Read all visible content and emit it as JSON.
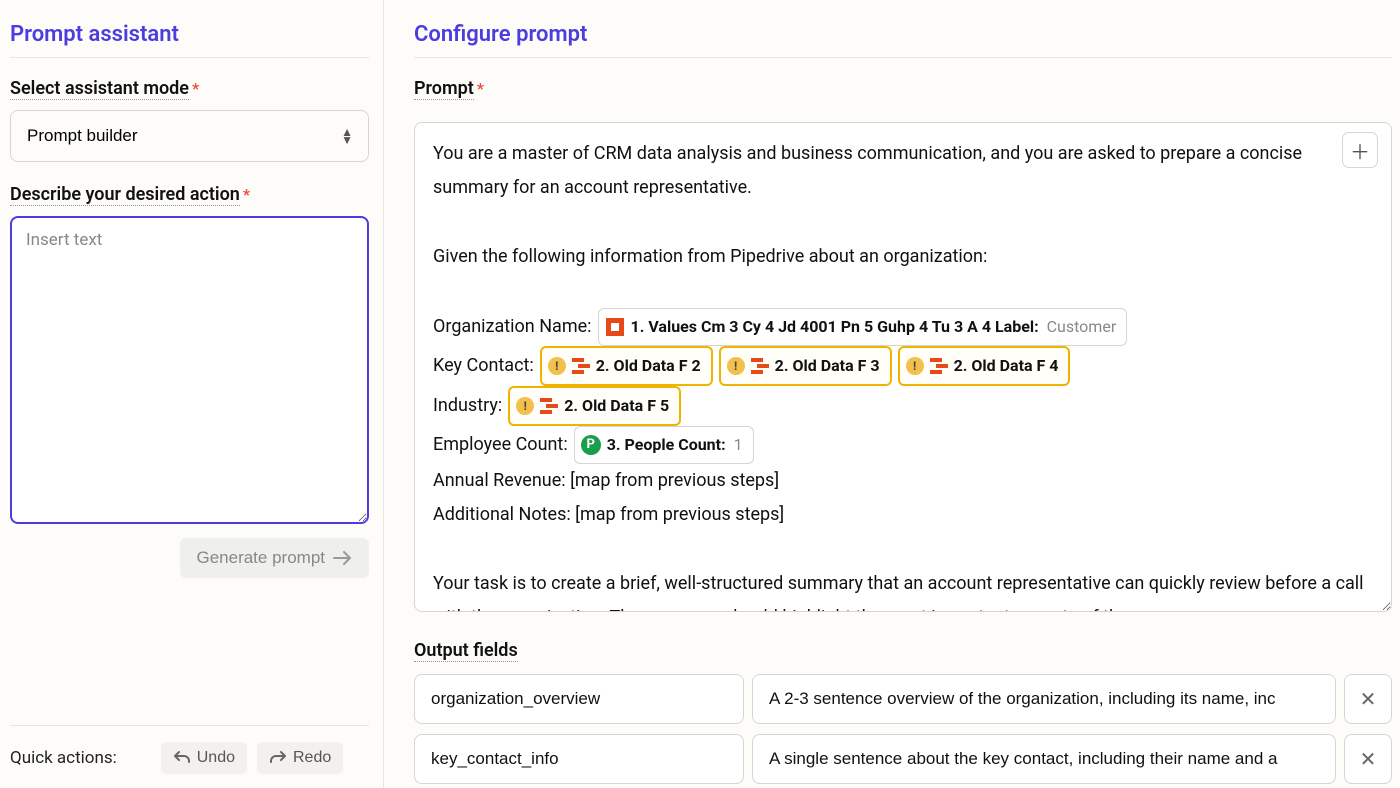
{
  "sidebar": {
    "title": "Prompt assistant",
    "mode_label": "Select assistant mode",
    "mode_value": "Prompt builder",
    "desc_label": "Describe your desired action",
    "desc_placeholder": "Insert text",
    "generate_label": "Generate prompt",
    "quick_label": "Quick actions:",
    "undo_label": "Undo",
    "redo_label": "Redo"
  },
  "main": {
    "title": "Configure prompt",
    "prompt_label": "Prompt",
    "prompt_text_1": "You are a master of CRM data analysis and business communication, and you are asked to prepare a concise summary for an account representative.",
    "prompt_text_2": "Given the following information from Pipedrive about an organization:",
    "org_label": "Organization Name:",
    "org_token": "1. Values Cm 3 Cy 4 Jd 4001 Pn 5 Guhp 4 Tu 3 A 4 Label:",
    "org_token_meta": "Customer",
    "kc_label": "Key Contact:",
    "kc_tokens": [
      "2. Old Data F 2",
      "2. Old Data F 3",
      "2. Old Data F 4"
    ],
    "ind_label": "Industry:",
    "ind_token": "2. Old Data F 5",
    "emp_label": "Employee Count:",
    "emp_token": "3. People Count:",
    "emp_token_meta": "1",
    "rev_line": "Annual Revenue: [map from previous steps]",
    "notes_line": "Additional Notes: [map from previous steps]",
    "prompt_text_3": "Your task is to create a brief, well-structured summary that an account representative can quickly review before a call with the organization. The summary should highlight the most important aspects of the",
    "output_label": "Output fields",
    "outputs": [
      {
        "name": "organization_overview",
        "desc": "A 2-3 sentence overview of the organization, including its name, inc"
      },
      {
        "name": "key_contact_info",
        "desc": "A single sentence about the key contact, including their name and a"
      }
    ]
  }
}
